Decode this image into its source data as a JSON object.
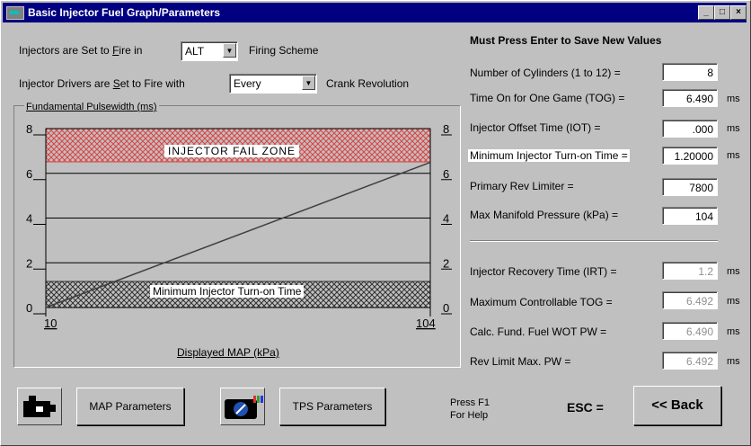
{
  "window": {
    "title": "Basic Injector Fuel Graph/Parameters",
    "minimize": "_",
    "maximize": "□",
    "close": "×"
  },
  "firing": {
    "label_prefix": "Injectors are Set to ",
    "label_underlined": "F",
    "label_rest": "ire in",
    "value": "ALT",
    "suffix": "Firing Scheme"
  },
  "drivers": {
    "label_prefix": "Injector Drivers are ",
    "label_underlined": "S",
    "label_rest": "et to Fire with",
    "value": "Every",
    "suffix": "Crank Revolution"
  },
  "params": {
    "heading": "Must Press Enter to Save New Values",
    "cylinders": {
      "label": "Number of Cylinders (1 to 12) =",
      "value": "8"
    },
    "tog": {
      "label": "Time On for One Game (TOG) =",
      "value": "6.490",
      "unit": "ms"
    },
    "iot": {
      "label": "Injector Offset Time (IOT) =",
      "value": ".000",
      "unit": "ms"
    },
    "min_turn_on": {
      "label": "Minimum Injector Turn-on Time =",
      "value": "1.20000",
      "unit": "ms"
    },
    "rev_limiter": {
      "label": "Primary Rev Limiter =",
      "value": "7800"
    },
    "max_map": {
      "label": "Max Manifold Pressure (kPa) =",
      "value": "104"
    },
    "irt": {
      "label": "Injector Recovery Time (IRT) =",
      "value": "1.2",
      "unit": "ms"
    },
    "max_tog": {
      "label": "Maximum Controllable TOG =",
      "value": "6.492",
      "unit": "ms"
    },
    "calc_pw": {
      "label": "Calc. Fund. Fuel WOT PW =",
      "value": "6.490",
      "unit": "ms"
    },
    "rev_pw": {
      "label": "Rev Limit Max. PW =",
      "value": "6.492",
      "unit": "ms"
    }
  },
  "graph": {
    "title": "Fundamental Pulsewidth (ms)",
    "fail_zone": "INJECTOR FAIL ZONE",
    "min_zone": "Minimum Injector Turn-on Time",
    "xlabel": "Displayed MAP (kPa)"
  },
  "chart_data": {
    "type": "line",
    "title": "Fundamental Pulsewidth (ms)",
    "xlabel": "Displayed MAP (kPa)",
    "ylabel": "Fundamental Pulsewidth (ms)",
    "xlim": [
      10,
      104
    ],
    "ylim": [
      0,
      8
    ],
    "x_ticks": [
      "10",
      "104"
    ],
    "y_ticks": [
      "0",
      "2",
      "4",
      "6",
      "8"
    ],
    "series": [
      {
        "x": [
          10,
          104
        ],
        "y": [
          0,
          6.49
        ]
      }
    ],
    "fail_zone_min": 6.492,
    "min_turn_on": 1.2,
    "grid": true,
    "colors": {
      "fail_zone": "#ff4040",
      "line": "#404040"
    }
  },
  "footer": {
    "map_params": "MAP Parameters",
    "tps_params": "TPS Parameters",
    "help": "Press F1\nFor Help",
    "esc": "ESC =",
    "back": "<< Back"
  }
}
